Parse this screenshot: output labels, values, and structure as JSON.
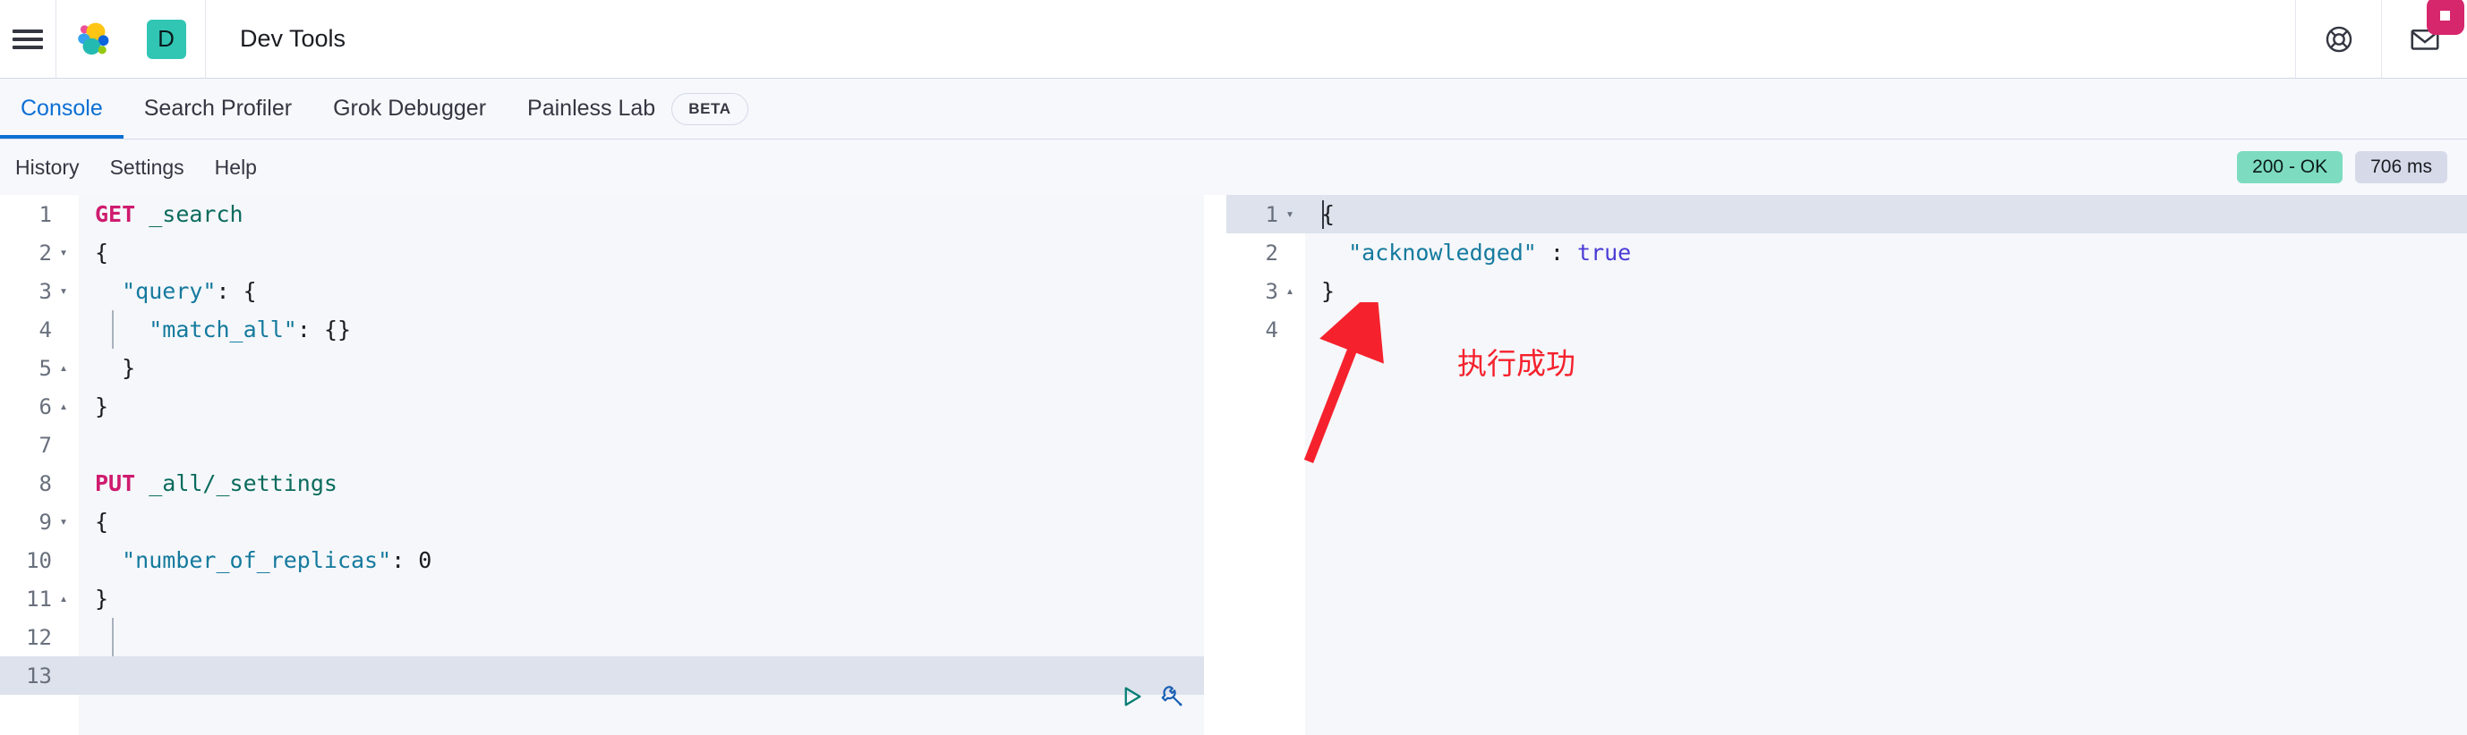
{
  "header": {
    "menu_icon": "hamburger-menu-icon",
    "brand_icon": "elastic-logo-icon",
    "space_avatar_label": "D",
    "app_title": "Dev Tools",
    "help_icon": "life-ring-help-icon",
    "mail_icon": "envelope-mail-icon",
    "notification_badge": ""
  },
  "tabs": [
    {
      "label": "Console",
      "active": true
    },
    {
      "label": "Search Profiler",
      "active": false
    },
    {
      "label": "Grok Debugger",
      "active": false
    },
    {
      "label": "Painless Lab",
      "active": false,
      "badge": "BETA"
    }
  ],
  "toolbar": {
    "items": [
      {
        "label": "History"
      },
      {
        "label": "Settings"
      },
      {
        "label": "Help"
      }
    ],
    "status": "200 - OK",
    "duration": "706 ms",
    "status_color": "#7ddcc0",
    "duration_color": "#d6dae8"
  },
  "request_editor": {
    "active_line": 13,
    "play_icon": "play-send-request-icon",
    "wrench_icon": "wrench-actions-icon",
    "lines": [
      {
        "n": 1,
        "fold": "",
        "text": "GET _search"
      },
      {
        "n": 2,
        "fold": "▾",
        "text": "{"
      },
      {
        "n": 3,
        "fold": "▾",
        "text": "  \"query\": {"
      },
      {
        "n": 4,
        "fold": "",
        "text": "    \"match_all\": {}"
      },
      {
        "n": 5,
        "fold": "▴",
        "text": "  }"
      },
      {
        "n": 6,
        "fold": "▴",
        "text": "}"
      },
      {
        "n": 7,
        "fold": "",
        "text": ""
      },
      {
        "n": 8,
        "fold": "",
        "text": "PUT _all/_settings"
      },
      {
        "n": 9,
        "fold": "▾",
        "text": "{"
      },
      {
        "n": 10,
        "fold": "",
        "text": "  \"number_of_replicas\": 0"
      },
      {
        "n": 11,
        "fold": "▴",
        "text": "}"
      },
      {
        "n": 12,
        "fold": "",
        "text": ""
      },
      {
        "n": 13,
        "fold": "",
        "text": ""
      }
    ]
  },
  "response_editor": {
    "active_line": 1,
    "lines": [
      {
        "n": 1,
        "fold": "▾",
        "text": "{"
      },
      {
        "n": 2,
        "fold": "",
        "text": "  \"acknowledged\" : true"
      },
      {
        "n": 3,
        "fold": "▴",
        "text": "}"
      },
      {
        "n": 4,
        "fold": "",
        "text": ""
      }
    ]
  },
  "annotation": {
    "text": "执行成功",
    "color": "#f5222d",
    "arrow_name": "red-annotation-arrow"
  }
}
